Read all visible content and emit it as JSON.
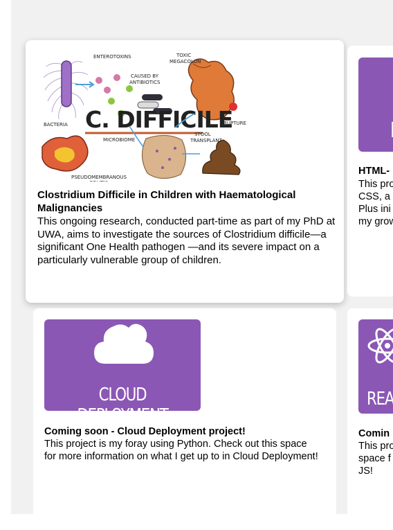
{
  "cards": [
    {
      "title": "Clostridium Difficile in Children with Haematological Malignancies",
      "description": "This ongoing research, conducted part-time as part of my PhD at UWA, aims to investigate the sources of Clostridium difficile—a significant One Health pathogen —and its severe impact on a particularly vulnerable group of children.",
      "illustration": {
        "main_label": "C. DIFFICILE",
        "labels": [
          "ENTEROTOXINS",
          "TOXIC MEGACOLON",
          "CAUSED BY ANTIBIOTICS",
          "RUPTURE",
          "BACTERIA",
          "MICROBIOME",
          "STOOL TRANSPLANT",
          "PSEUDOMEMBRANOUS COLITIS"
        ]
      }
    },
    {
      "title_partial": "HTML-",
      "description_lines": [
        "This pro",
        "CSS, a",
        "Plus ini",
        "my grow"
      ],
      "thumb_letter": "H"
    },
    {
      "title": "Coming soon - Cloud Deployment project!",
      "description": "This project is my foray using Python. Check out this space for more information on what I get up to in Cloud Deployment!",
      "thumb_label": "CLOUD DEPLOYMENT",
      "thumb_icon": "cloud-icon"
    },
    {
      "title_partial": "Comin",
      "description_lines": [
        "This pro",
        "space f",
        "JS!"
      ],
      "thumb_label_partial": "REA",
      "thumb_icon": "react-atom-icon"
    }
  ],
  "colors": {
    "thumb_purple": "#8b57b5",
    "page_background": "#f1f1f1",
    "card_background": "#ffffff"
  }
}
